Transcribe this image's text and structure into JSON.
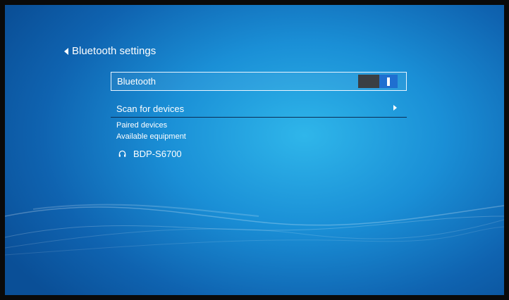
{
  "header": {
    "title": "Bluetooth settings"
  },
  "bluetooth_row": {
    "label": "Bluetooth",
    "enabled": true
  },
  "scan_row": {
    "label": "Scan for devices"
  },
  "sections": {
    "paired": "Paired devices",
    "available": "Available equipment"
  },
  "devices": [
    {
      "name": "BDP-S6700",
      "icon": "headphones-icon"
    }
  ],
  "colors": {
    "background": "#1a8fd6",
    "toggle_on": "#1f6fd0",
    "toggle_off": "#3a3f44"
  }
}
